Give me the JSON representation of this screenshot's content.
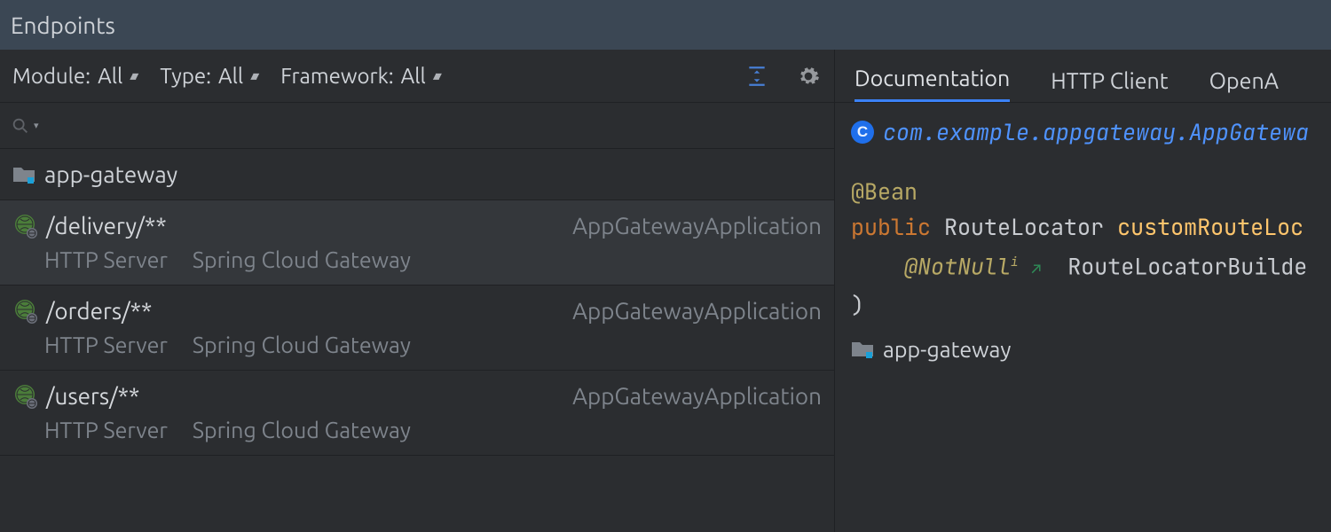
{
  "titlebar": {
    "title": "Endpoints"
  },
  "filters": {
    "module_label": "Module:",
    "module_value": "All",
    "type_label": "Type:",
    "type_value": "All",
    "framework_label": "Framework:",
    "framework_value": "All"
  },
  "search": {
    "placeholder": ""
  },
  "tree": {
    "root_module": "app-gateway"
  },
  "endpoints": [
    {
      "path": "/delivery/**",
      "class": "AppGatewayApplication",
      "server": "HTTP Server",
      "framework": "Spring Cloud Gateway",
      "selected": true
    },
    {
      "path": "/orders/**",
      "class": "AppGatewayApplication",
      "server": "HTTP Server",
      "framework": "Spring Cloud Gateway",
      "selected": false
    },
    {
      "path": "/users/**",
      "class": "AppGatewayApplication",
      "server": "HTTP Server",
      "framework": "Spring Cloud Gateway",
      "selected": false
    }
  ],
  "tabs": [
    {
      "id": "doc",
      "label": "Documentation",
      "active": true
    },
    {
      "id": "http",
      "label": "HTTP Client",
      "active": false
    },
    {
      "id": "open",
      "label": "OpenA",
      "active": false
    }
  ],
  "doc": {
    "class_badge": "C",
    "fqn": "com.example.appgateway.AppGatewa",
    "annotation": "@Bean",
    "keyword": "public",
    "return_type": "RouteLocator",
    "method_name": "customRouteLoc",
    "param_annotation": "@NotNull",
    "param_sup": "i",
    "arrow": "↗",
    "param_type": "RouteLocatorBuilde",
    "close_paren": ")",
    "module": "app-gateway"
  }
}
